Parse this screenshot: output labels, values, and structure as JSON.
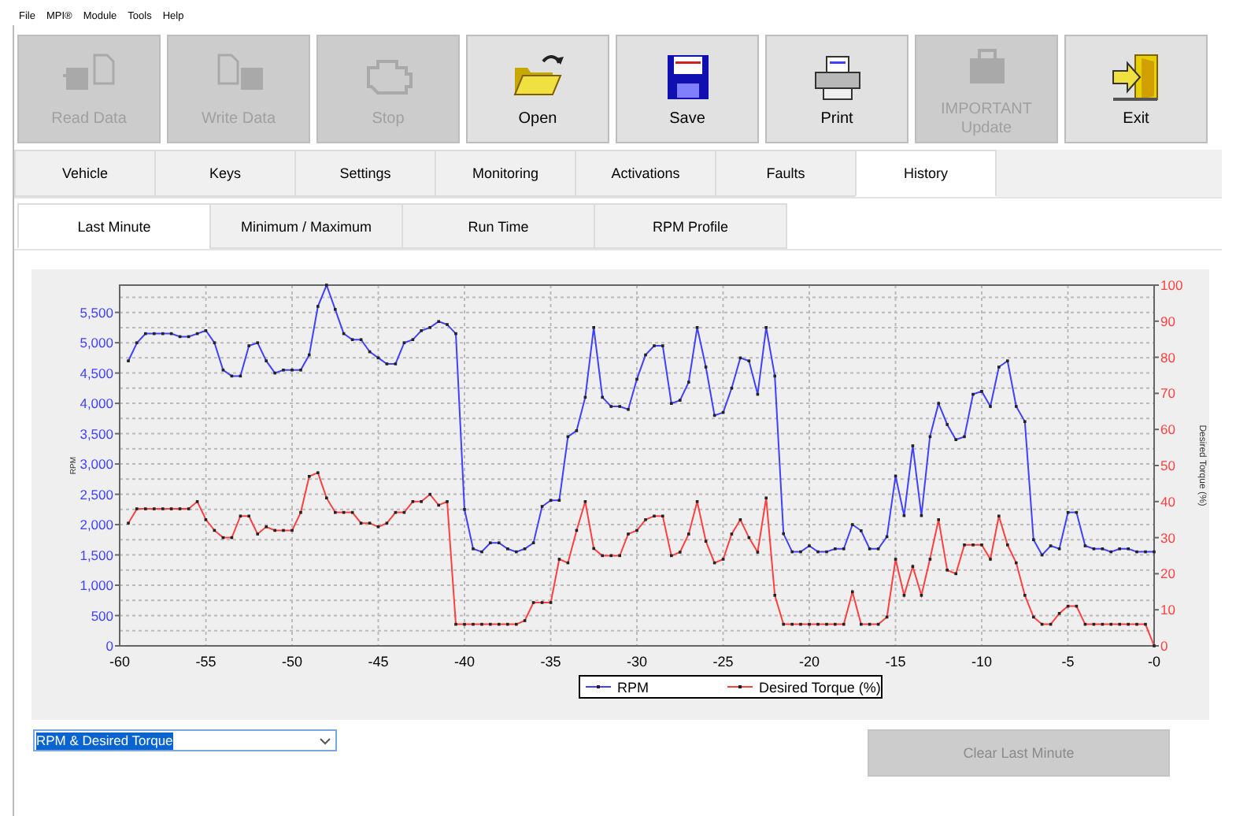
{
  "menu": [
    "File",
    "MPI®",
    "Module",
    "Tools",
    "Help"
  ],
  "toolbar": [
    {
      "label": "Read Data",
      "kind": "read",
      "disabled": true
    },
    {
      "label": "Write Data",
      "kind": "write",
      "disabled": true
    },
    {
      "label": "Stop",
      "kind": "engine",
      "disabled": true
    },
    {
      "label": "Open",
      "kind": "open",
      "disabled": false
    },
    {
      "label": "Save",
      "kind": "save",
      "disabled": false
    },
    {
      "label": "Print",
      "kind": "print",
      "disabled": false
    },
    {
      "label": "IMPORTANT\nUpdate",
      "kind": "update",
      "disabled": true
    },
    {
      "label": "Exit",
      "kind": "exit",
      "disabled": false
    }
  ],
  "tabs": [
    {
      "label": "Vehicle",
      "selected": false
    },
    {
      "label": "Keys",
      "selected": false
    },
    {
      "label": "Settings",
      "selected": false
    },
    {
      "label": "Monitoring",
      "selected": false
    },
    {
      "label": "Activations",
      "selected": false
    },
    {
      "label": "Faults",
      "selected": false
    },
    {
      "label": "History",
      "selected": true
    }
  ],
  "subtabs": [
    {
      "label": "Last Minute",
      "selected": true
    },
    {
      "label": "Minimum / Maximum",
      "selected": false
    },
    {
      "label": "Run Time",
      "selected": false
    },
    {
      "label": "RPM Profile",
      "selected": false
    }
  ],
  "chart_data": {
    "type": "line",
    "grid": true,
    "legend": true,
    "ylabel": "RPM",
    "y2label": "Desired Torque (%)",
    "xlim": [
      -60,
      0
    ],
    "ylim": [
      0,
      5950
    ],
    "y2lim": [
      0,
      100
    ],
    "xticks": [
      -60,
      -55,
      -50,
      -45,
      -40,
      -35,
      -30,
      -25,
      -20,
      -15,
      -10,
      -5,
      {
        "value": 0,
        "label": "-0"
      }
    ],
    "yticks": [
      0,
      500,
      {
        "value": 1000,
        "label": "1,000"
      },
      {
        "value": 1500,
        "label": "1,500"
      },
      {
        "value": 2000,
        "label": "2,000"
      },
      {
        "value": 2500,
        "label": "2,500"
      },
      {
        "value": 3000,
        "label": "3,000"
      },
      {
        "value": 3500,
        "label": "3,500"
      },
      {
        "value": 4000,
        "label": "4,000"
      },
      {
        "value": 4500,
        "label": "4,500"
      },
      {
        "value": 5000,
        "label": "5,000"
      },
      {
        "value": 5500,
        "label": "5,500"
      }
    ],
    "y2ticks": [
      0,
      10,
      20,
      30,
      40,
      50,
      60,
      70,
      80,
      90,
      100
    ],
    "x": [
      -59.5,
      -59,
      -58.5,
      -58,
      -57.5,
      -57,
      -56.5,
      -56,
      -55.5,
      -55,
      -54.5,
      -54,
      -53.5,
      -53,
      -52.5,
      -52,
      -51.5,
      -51,
      -50.5,
      -50,
      -49.5,
      -49,
      -48.5,
      -48,
      -47.5,
      -47,
      -46.5,
      -46,
      -45.5,
      -45,
      -44.5,
      -44,
      -43.5,
      -43,
      -42.5,
      -42,
      -41.5,
      -41,
      -40.5,
      -40,
      -39.5,
      -39,
      -38.5,
      -38,
      -37.5,
      -37,
      -36.5,
      -36,
      -35.5,
      -35,
      -34.5,
      -34,
      -33.5,
      -33,
      -32.5,
      -32,
      -31.5,
      -31,
      -30.5,
      -30,
      -29.5,
      -29,
      -28.5,
      -28,
      -27.5,
      -27,
      -26.5,
      -26,
      -25.5,
      -25,
      -24.5,
      -24,
      -23.5,
      -23,
      -22.5,
      -22,
      -21.5,
      -21,
      -20.5,
      -20,
      -19.5,
      -19,
      -18.5,
      -18,
      -17.5,
      -17,
      -16.5,
      -16,
      -15.5,
      -15,
      -14.5,
      -14,
      -13.5,
      -13,
      -12.5,
      -12,
      -11.5,
      -11,
      -10.5,
      -10,
      -9.5,
      -9,
      -8.5,
      -8,
      -7.5,
      -7,
      -6.5,
      -6,
      -5.5,
      -5,
      -4.5,
      -4,
      -3.5,
      -3,
      -2.5,
      -2,
      -1.5,
      -1,
      -0.5,
      0
    ],
    "series": [
      {
        "name": "RPM",
        "color": "#4040ff",
        "marker": true,
        "values": [
          4700,
          5000,
          5150,
          5150,
          5150,
          5150,
          5100,
          5100,
          5150,
          5200,
          5000,
          4550,
          4450,
          4450,
          4950,
          5000,
          4700,
          4500,
          4550,
          4550,
          4550,
          4800,
          5600,
          5950,
          5550,
          5150,
          5050,
          5050,
          4850,
          4750,
          4650,
          4650,
          5000,
          5050,
          5200,
          5250,
          5350,
          5300,
          5150,
          2250,
          1600,
          1550,
          1700,
          1700,
          1600,
          1550,
          1600,
          1700,
          2300,
          2400,
          2400,
          3450,
          3550,
          4100,
          5250,
          4100,
          3950,
          3950,
          3900,
          4400,
          4800,
          4950,
          4950,
          4000,
          4050,
          4350,
          5250,
          4600,
          3800,
          3850,
          4250,
          4750,
          4700,
          4150,
          5250,
          4450,
          1850,
          1550,
          1550,
          1650,
          1550,
          1550,
          1600,
          1600,
          2000,
          1900,
          1600,
          1600,
          1800,
          2800,
          2150,
          3300,
          2150,
          3450,
          4000,
          3650,
          3400,
          3450,
          4150,
          4200,
          3950,
          4600,
          4700,
          3950,
          3700,
          1750,
          1500,
          1650,
          1600,
          2200,
          2200,
          1650,
          1600,
          1600,
          1550,
          1600,
          1600,
          1550,
          1550,
          1550
        ]
      },
      {
        "name": "Desired Torque (%)",
        "color": "#ff4040",
        "axis": "y2",
        "marker": true,
        "values": [
          34,
          38,
          38,
          38,
          38,
          38,
          38,
          38,
          40,
          35,
          32,
          30,
          30,
          36,
          36,
          31,
          33,
          32,
          32,
          32,
          37,
          47,
          48,
          41,
          37,
          37,
          37,
          34,
          34,
          33,
          34,
          37,
          37,
          40,
          40,
          42,
          39,
          40,
          6,
          6,
          6,
          6,
          6,
          6,
          6,
          6,
          7,
          12,
          12,
          12,
          24,
          23,
          32,
          40,
          27,
          25,
          25,
          25,
          31,
          32,
          35,
          36,
          36,
          25,
          26,
          31,
          40,
          29,
          23,
          24,
          31,
          35,
          30,
          26,
          41,
          14,
          6,
          6,
          6,
          6,
          6,
          6,
          6,
          6,
          15,
          6,
          6,
          6,
          8,
          24,
          14,
          22,
          14,
          24,
          35,
          21,
          20,
          28,
          28,
          28,
          24,
          36,
          28,
          23,
          14,
          8,
          6,
          6,
          9,
          11,
          11,
          6,
          6,
          6,
          6,
          6,
          6,
          6,
          6,
          0
        ]
      }
    ]
  },
  "view_select": {
    "value": "RPM & Desired Torque"
  },
  "clear_button": {
    "label": "Clear Last Minute",
    "disabled": true
  }
}
